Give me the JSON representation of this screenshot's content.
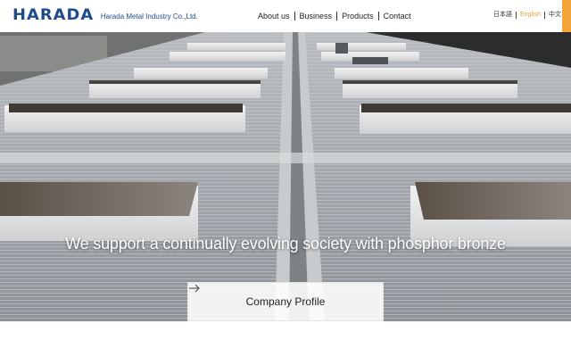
{
  "brand": {
    "logo_text": "HARADA",
    "company_name": "Harada Metal Industry Co.,Ltd."
  },
  "nav": {
    "items": [
      {
        "label": "About us"
      },
      {
        "label": "Business"
      },
      {
        "label": "Products"
      },
      {
        "label": "Contact"
      }
    ]
  },
  "languages": {
    "items": [
      {
        "label": "日本語"
      },
      {
        "label": "English"
      },
      {
        "label": "中文"
      }
    ],
    "active": "English"
  },
  "hero": {
    "headline": "We support a continually evolving society with phosphor bronze",
    "cta_label": "Company Profile",
    "cta_icon": "arrow-right-icon"
  },
  "colors": {
    "brand_blue": "#1f4a8c",
    "accent_orange": "#f2a53a",
    "active_language": "#e8a23a"
  }
}
